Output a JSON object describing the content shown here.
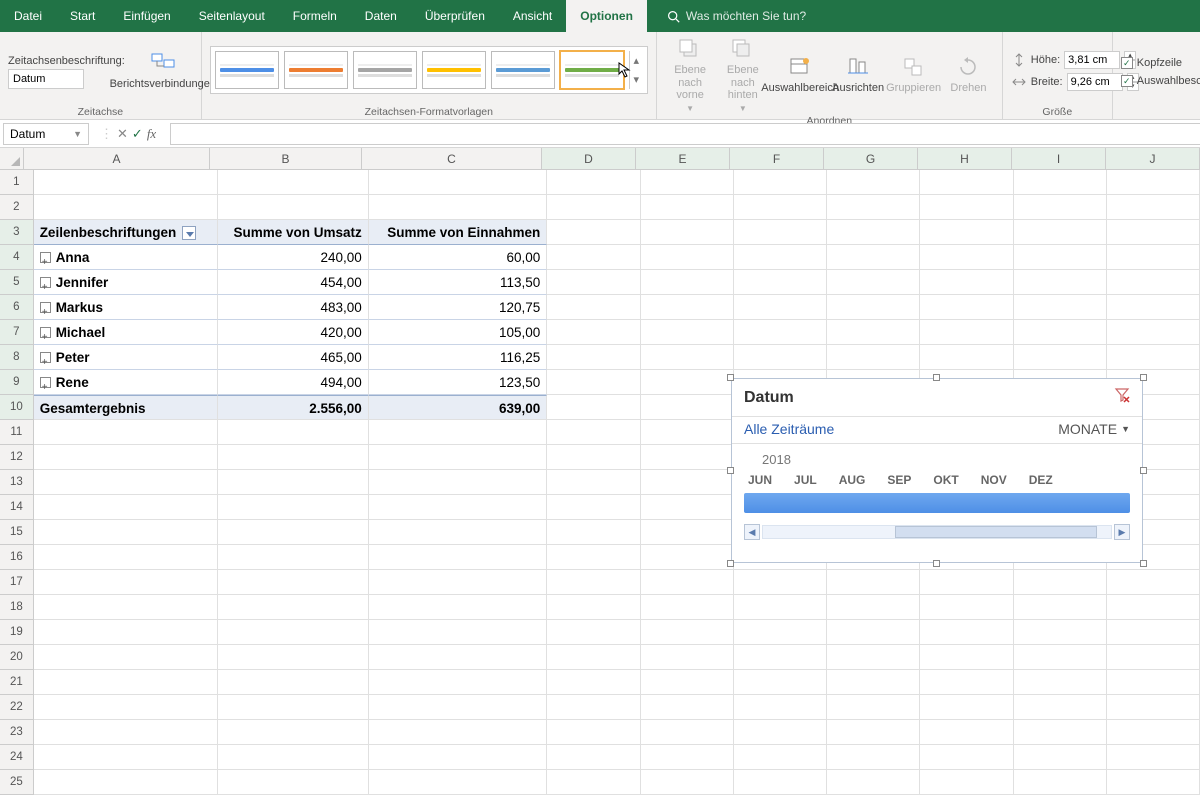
{
  "tabs": {
    "datei": "Datei",
    "start": "Start",
    "einfuegen": "Einfügen",
    "seitenlayout": "Seitenlayout",
    "formeln": "Formeln",
    "daten": "Daten",
    "ueberpruefen": "Überprüfen",
    "ansicht": "Ansicht",
    "optionen": "Optionen"
  },
  "search_placeholder": "Was möchten Sie tun?",
  "ribbon": {
    "caption_label": "Zeitachsenbeschriftung:",
    "caption_value": "Datum",
    "group_zeitachse": "Zeitachse",
    "berichtsverbindungen": "Berichtsverbindungen",
    "group_formatvorlagen": "Zeitachsen-Formatvorlagen",
    "ebene_vorne": "Ebene nach vorne",
    "ebene_hinten": "Ebene nach hinten",
    "auswahlbereich": "Auswahlbereich",
    "ausrichten": "Ausrichten",
    "gruppieren": "Gruppieren",
    "drehen": "Drehen",
    "group_anordnen": "Anordnen",
    "hoehe_label": "Höhe:",
    "hoehe_val": "3,81 cm",
    "breite_label": "Breite:",
    "breite_val": "9,26 cm",
    "group_groesse": "Größe",
    "kopfzeile": "Kopfzeile",
    "auswahlbeschr": "Auswahlbesc"
  },
  "style_colors": [
    "#4e8fe6",
    "#ed7d31",
    "#a5a5a5",
    "#ffc000",
    "#5b9bd5",
    "#70ad47"
  ],
  "namebox": "Datum",
  "columns": [
    "A",
    "B",
    "C",
    "D",
    "E",
    "F",
    "G",
    "H",
    "I",
    "J"
  ],
  "pivot": {
    "h1": "Zeilenbeschriftungen",
    "h2": "Summe von Umsatz",
    "h3": "Summe von Einnahmen",
    "rows": [
      {
        "n": "Anna",
        "u": "240,00",
        "e": "60,00"
      },
      {
        "n": "Jennifer",
        "u": "454,00",
        "e": "113,50"
      },
      {
        "n": "Markus",
        "u": "483,00",
        "e": "120,75"
      },
      {
        "n": "Michael",
        "u": "420,00",
        "e": "105,00"
      },
      {
        "n": "Peter",
        "u": "465,00",
        "e": "116,25"
      },
      {
        "n": "Rene",
        "u": "494,00",
        "e": "123,50"
      }
    ],
    "total_label": "Gesamtergebnis",
    "total_u": "2.556,00",
    "total_e": "639,00"
  },
  "slicer": {
    "title": "Datum",
    "subtitle": "Alle Zeiträume",
    "period_label": "MONATE",
    "year": "2018",
    "months": [
      "JUN",
      "JUL",
      "AUG",
      "SEP",
      "OKT",
      "NOV",
      "DEZ"
    ]
  }
}
